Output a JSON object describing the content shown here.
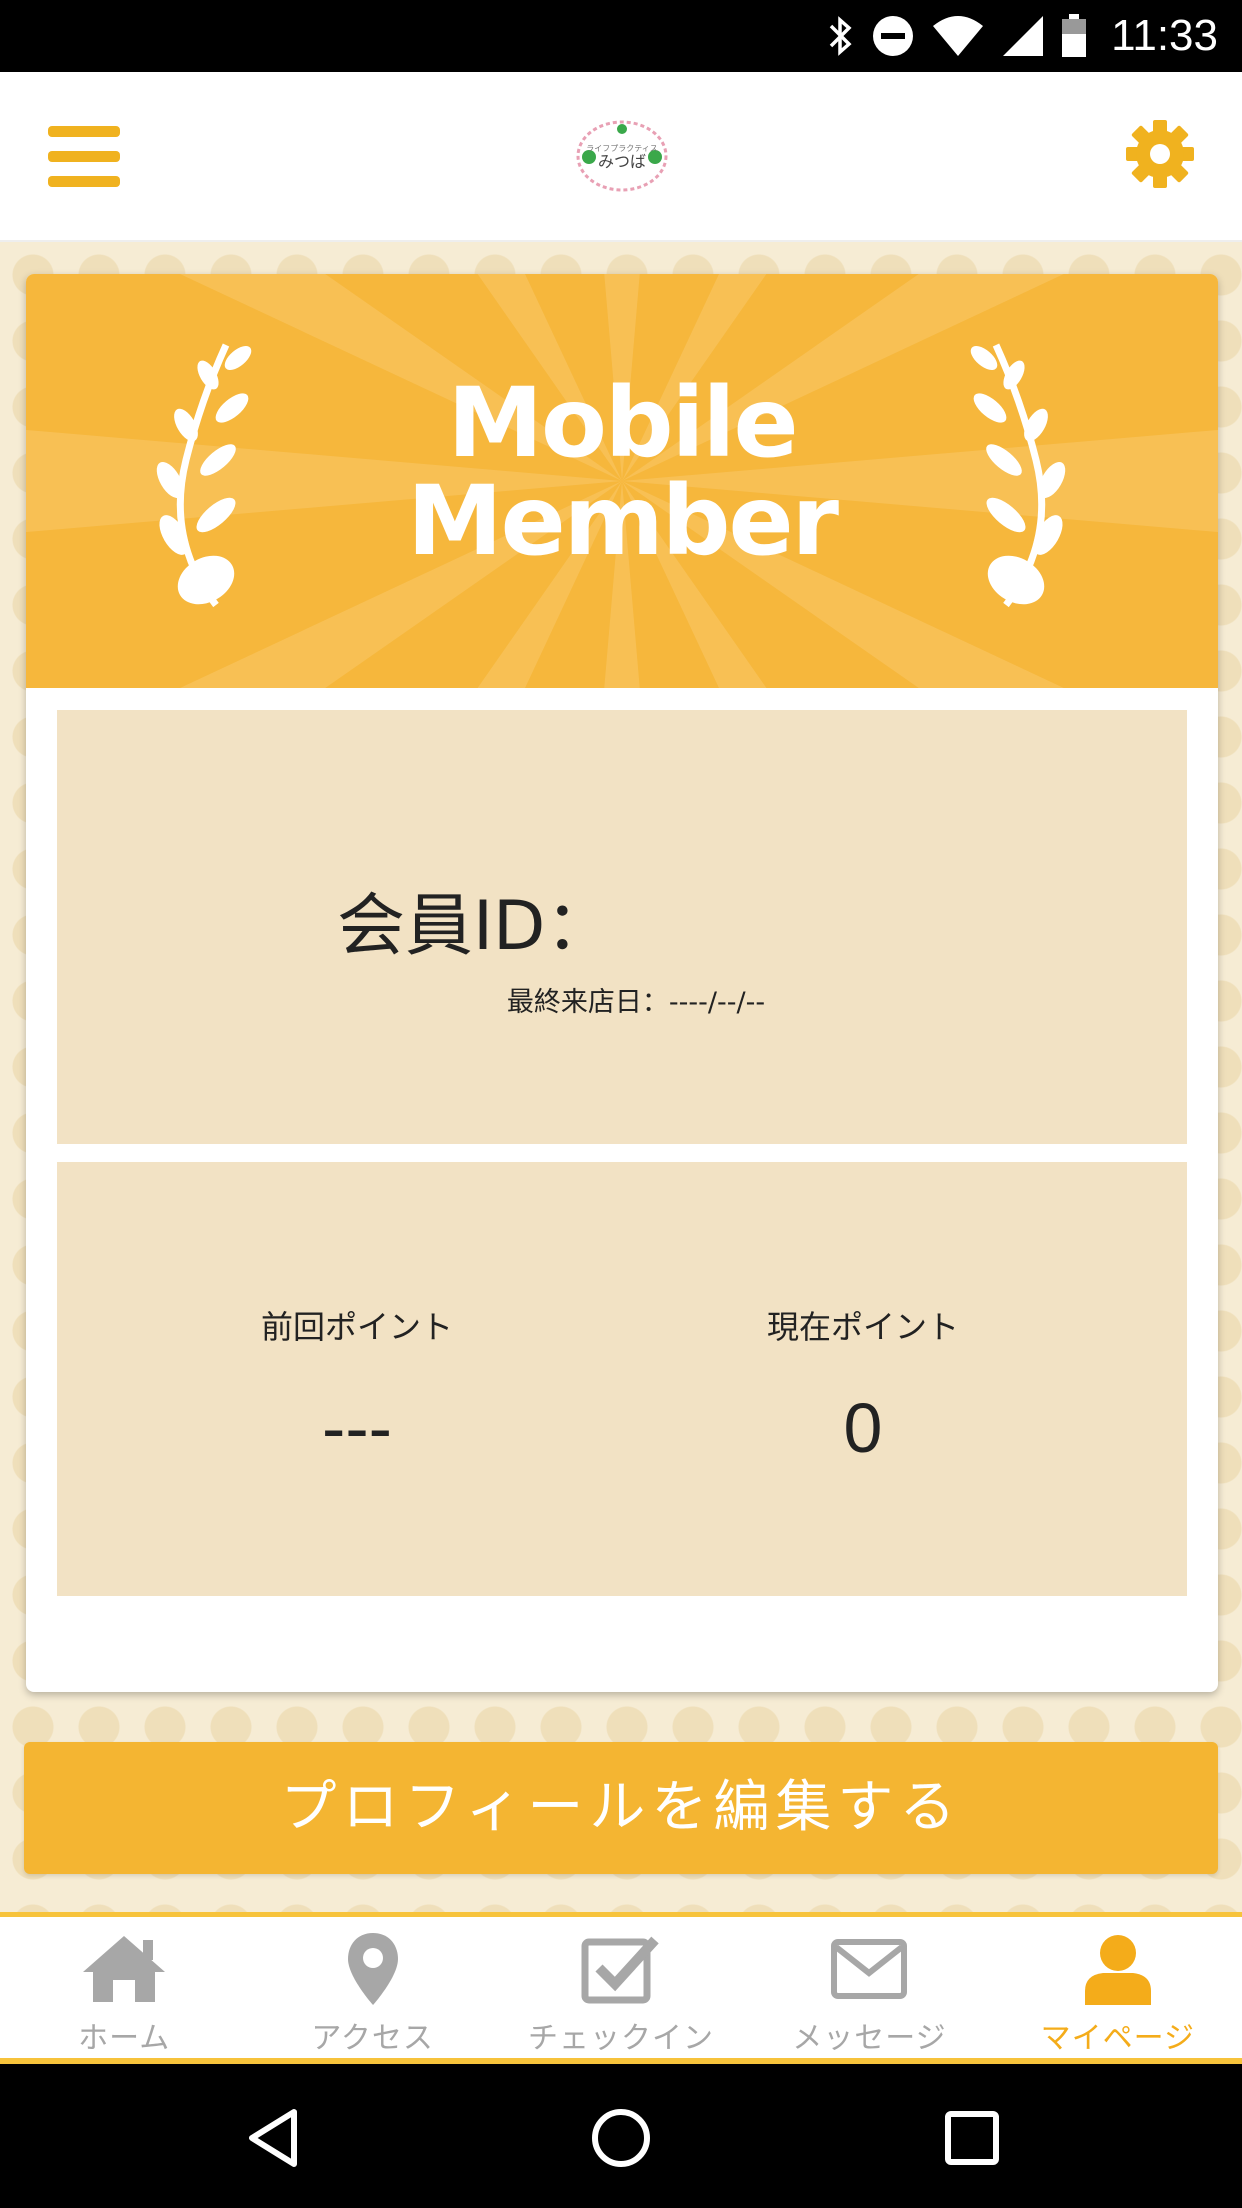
{
  "status_bar": {
    "time": "11:33",
    "icons": [
      "bluetooth-icon",
      "do-not-disturb-icon",
      "wifi-icon",
      "cell-signal-icon",
      "battery-icon"
    ]
  },
  "header": {
    "menu_icon": "hamburger-menu-icon",
    "logo_text": "みつば",
    "logo_subtext": "ライフプラクティス",
    "settings_icon": "gear-icon"
  },
  "banner": {
    "title_line1": "Mobile",
    "title_line2": "Member"
  },
  "member": {
    "id_label": "会員ID：",
    "id_value": "",
    "last_visit_label": "最終来店日：",
    "last_visit_value": "----/--/--"
  },
  "points": {
    "previous_label": "前回ポイント",
    "previous_value": "---",
    "current_label": "現在ポイント",
    "current_value": "0"
  },
  "edit_profile_label": "プロフィールを編集する",
  "bottom_nav": {
    "items": [
      {
        "label": "ホーム",
        "icon": "home-icon"
      },
      {
        "label": "アクセス",
        "icon": "map-pin-icon"
      },
      {
        "label": "チェックイン",
        "icon": "checkin-icon"
      },
      {
        "label": "メッセージ",
        "icon": "envelope-icon"
      },
      {
        "label": "マイページ",
        "icon": "user-icon"
      }
    ],
    "active_index": 4
  },
  "system_nav": [
    "back-icon",
    "home-circle-icon",
    "recents-icon"
  ],
  "colors": {
    "accent": "#f4b532",
    "banner": "#f6b73c",
    "panel": "#f2e2c4",
    "inactive_nav": "#a7a7a7",
    "active_nav": "#f4ac1a"
  }
}
